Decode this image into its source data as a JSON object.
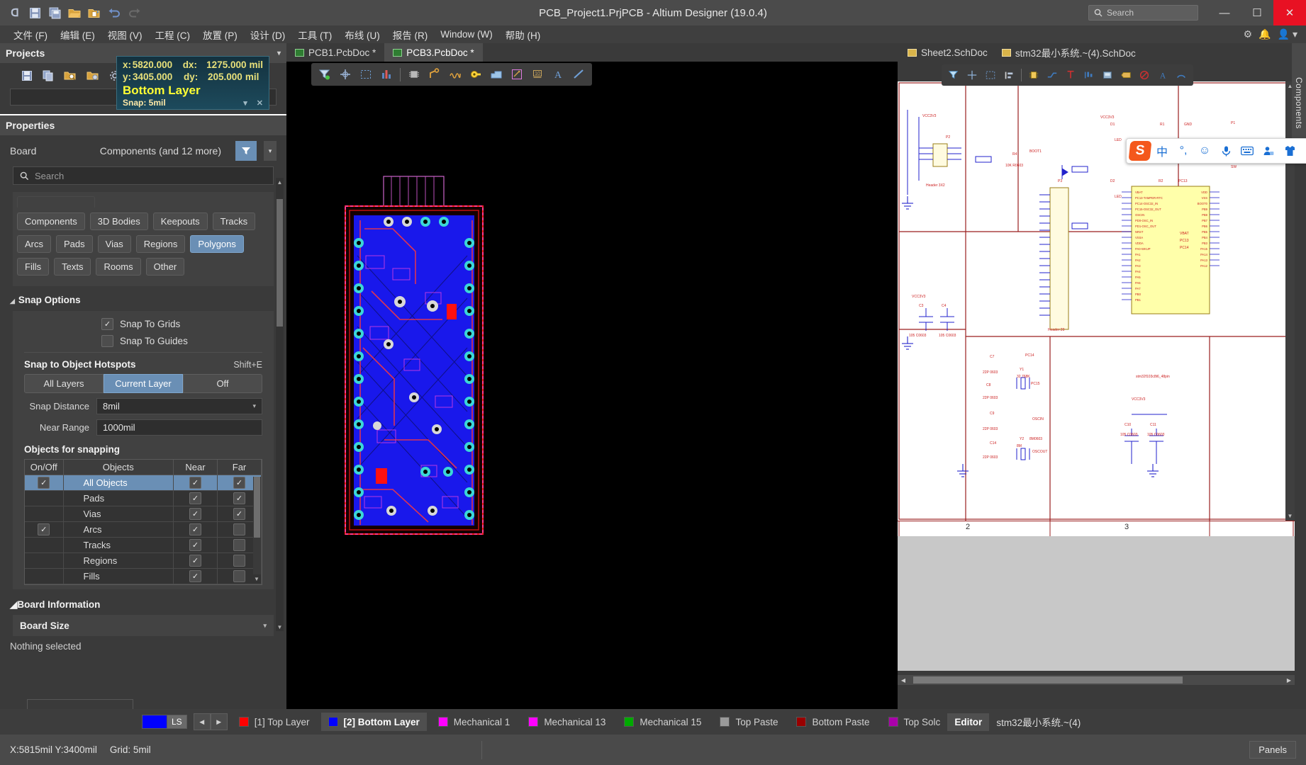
{
  "window": {
    "title": "PCB_Project1.PrjPCB - Altium Designer (19.0.4)",
    "search_placeholder": "Search",
    "minimize": "—",
    "maximize": "☐",
    "close": "✕"
  },
  "quick_access": [
    {
      "name": "altium-logo",
      "glyph": "ᗡ"
    },
    {
      "name": "save-icon",
      "glyph": "🖫"
    },
    {
      "name": "save-all-icon",
      "glyph": "🖬"
    },
    {
      "name": "open-icon",
      "glyph": "🗁"
    },
    {
      "name": "open-project-icon",
      "glyph": "🗀"
    },
    {
      "name": "undo-icon",
      "glyph": "↩"
    },
    {
      "name": "redo-icon",
      "glyph": "↪"
    }
  ],
  "menu": [
    "文件 (F)",
    "编辑 (E)",
    "视图 (V)",
    "工程 (C)",
    "放置 (P)",
    "设计 (D)",
    "工具 (T)",
    "布线 (U)",
    "报告 (R)",
    "Window (W)",
    "帮助 (H)"
  ],
  "menu_right": [
    "⚙",
    "🔔",
    "👤 ▾"
  ],
  "projects_panel": {
    "title": "Projects",
    "caret": "▾",
    "toolbar": [
      "save-icon",
      "copy-icon",
      "open-folder-search-icon",
      "folder-config-icon",
      "gear-icon"
    ]
  },
  "properties_panel": {
    "title": "Properties",
    "board_label": "Board",
    "board_value": "Components (and 12 more)",
    "filter_icon": "▼",
    "filter_caret": "▾",
    "search_placeholder": "Search",
    "chips_row1": [
      "Components",
      "3D Bodies",
      "Keepouts",
      "Tracks"
    ],
    "chips_row2": [
      "Arcs",
      "Pads",
      "Vias",
      "Regions",
      "Polygons"
    ],
    "chips_row3": [
      "Fills",
      "Texts",
      "Rooms",
      "Other"
    ],
    "selected_chip": "Polygons",
    "snap_options": {
      "title": "Snap Options",
      "snap_to_grids": {
        "label": "Snap To Grids",
        "checked": true
      },
      "snap_to_guides": {
        "label": "Snap To Guides",
        "checked": false
      },
      "hotspots_label": "Snap to Object Hotspots",
      "hotspots_shortcut": "Shift+E",
      "hotspot_modes": [
        "All Layers",
        "Current Layer",
        "Off"
      ],
      "hotspot_selected": "Current Layer",
      "snap_distance_label": "Snap Distance",
      "snap_distance_value": "8mil",
      "near_range_label": "Near Range",
      "near_range_value": "1000mil"
    },
    "objects_for_snapping": {
      "title": "Objects for snapping",
      "columns": [
        "On/Off",
        "Objects",
        "Near",
        "Far"
      ],
      "rows": [
        {
          "onoff": true,
          "object": "All Objects",
          "near": true,
          "far": true,
          "selected": true
        },
        {
          "onoff": false,
          "object": "Pads",
          "near": true,
          "far": true,
          "selected": false
        },
        {
          "onoff": false,
          "object": "Vias",
          "near": true,
          "far": true,
          "selected": false
        },
        {
          "onoff": true,
          "object": "Arcs",
          "near": true,
          "far": false,
          "selected": false
        },
        {
          "onoff": false,
          "object": "Tracks",
          "near": true,
          "far": false,
          "selected": false
        },
        {
          "onoff": false,
          "object": "Regions",
          "near": true,
          "far": false,
          "selected": false
        },
        {
          "onoff": false,
          "object": "Fills",
          "near": true,
          "far": false,
          "selected": false
        }
      ]
    },
    "board_information": {
      "title": "Board Information",
      "board_size_label": "Board Size",
      "caret": "▾",
      "nothing_selected": "Nothing selected"
    }
  },
  "pcb_tabs": [
    {
      "label": "PCB1.PcbDoc *",
      "active": false
    },
    {
      "label": "PCB3.PcbDoc *",
      "active": true
    }
  ],
  "schematic_tabs": [
    {
      "label": "Sheet2.SchDoc",
      "active": false
    },
    {
      "label": "stm32最小系统.~(4).SchDoc",
      "active": true
    }
  ],
  "hud": {
    "x_label": "x:",
    "x_value": "5820.000",
    "dx_label": "dx:",
    "dx_value": "1275.000",
    "dx_unit": "mil",
    "y_label": "y:",
    "y_value": "3405.000",
    "dy_label": "dy:",
    "dy_value": "205.000",
    "dy_unit": "mil",
    "layer": "Bottom Layer",
    "snap": "Snap: 5mil",
    "caret": "▾",
    "close": "✕"
  },
  "pcb_toolbar": [
    "filter-icon",
    "crosshair-icon",
    "select-area-icon",
    "measure-icon",
    "component-icon",
    "route-trace-icon",
    "differential-pair-icon",
    "via-icon",
    "polygon-pour-icon",
    "dimension-icon",
    "coordinate-icon",
    "text-icon",
    "line-icon"
  ],
  "schematic_toolbar": [
    "filter-icon",
    "crosshair-icon",
    "select-area-icon",
    "align-icon",
    "component-icon",
    "wire-icon",
    "power-port-icon",
    "net-label-icon",
    "bus-icon",
    "port-icon",
    "no-erc-icon",
    "text-icon",
    "arc-icon"
  ],
  "ime_toolbar": {
    "logo": "S",
    "buttons": [
      "中",
      "°,",
      "☺",
      "🎤",
      "⌨",
      "👤",
      "👕",
      "▦"
    ]
  },
  "sheet_border": {
    "left_number": "2",
    "right_number": "3"
  },
  "layer_bar": {
    "ls_label": "LS",
    "ls_color": "#0000ff",
    "prev": "◀",
    "next": "▶",
    "layers": [
      {
        "label": "[1] Top Layer",
        "color": "#ff0000",
        "active": false
      },
      {
        "label": "[2] Bottom Layer",
        "color": "#0000ff",
        "active": true
      },
      {
        "label": "Mechanical 1",
        "color": "#ff00ff",
        "active": false
      },
      {
        "label": "Mechanical 13",
        "color": "#ff00ff",
        "active": false
      },
      {
        "label": "Mechanical 15",
        "color": "#00aa00",
        "active": false
      },
      {
        "label": "Top Paste",
        "color": "#9a9a9a",
        "active": false
      },
      {
        "label": "Bottom Paste",
        "color": "#990000",
        "active": false
      },
      {
        "label": "Top Solc",
        "color": "#aa00aa",
        "active": false
      }
    ],
    "editor_tab": "Editor",
    "editor_doc": "stm32最小系统.~(4)"
  },
  "status_bar": {
    "coords": "X:5815mil Y:3400mil",
    "grid": "Grid: 5mil",
    "panels_button": "Panels"
  },
  "right_rail": {
    "label": "Components"
  },
  "colors": {
    "accent": "#6a8fb5",
    "title_bar": "#4b4b4b",
    "panel_bg": "#3a3a3a",
    "hud_bg": "#1d4a5c",
    "hud_text": "#e8e07a",
    "hud_layer": "#ffff33",
    "close_red": "#e81123"
  }
}
